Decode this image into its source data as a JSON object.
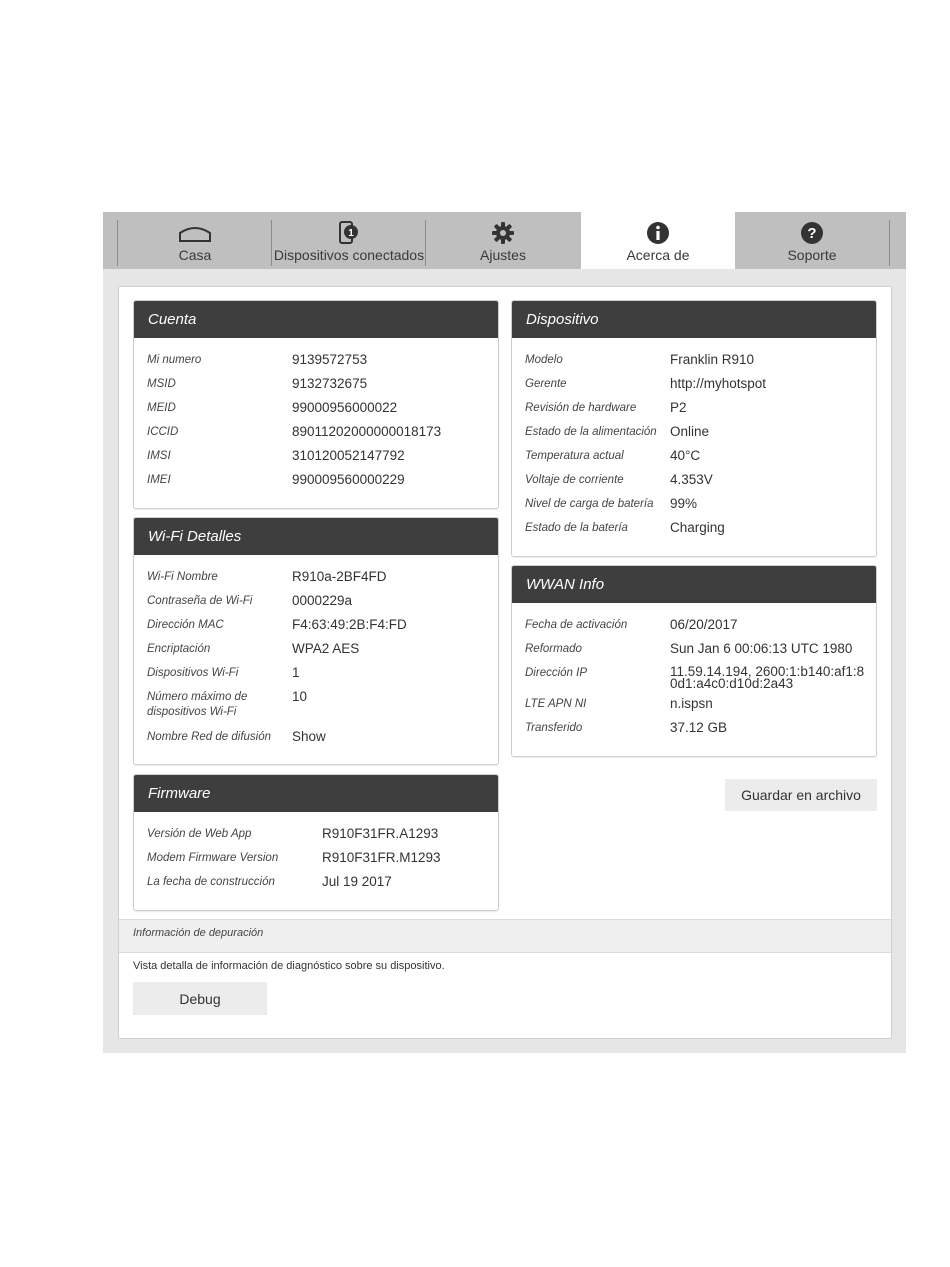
{
  "tabs": [
    {
      "label": "Casa",
      "icon": "home-icon"
    },
    {
      "label": "Dispositivos conectados",
      "icon": "connected-devices-icon"
    },
    {
      "label": "Ajustes",
      "icon": "gear-icon"
    },
    {
      "label": "Acerca de",
      "icon": "info-icon"
    },
    {
      "label": "Soporte",
      "icon": "help-icon"
    }
  ],
  "active_tab": "Acerca de",
  "cuenta": {
    "title": "Cuenta",
    "rows": [
      {
        "label": "Mi numero",
        "value": "9139572753"
      },
      {
        "label": "MSID",
        "value": "9132732675"
      },
      {
        "label": "MEID",
        "value": "99000956000022"
      },
      {
        "label": "ICCID",
        "value": "89011202000000018173"
      },
      {
        "label": "IMSI",
        "value": "310120052147792"
      },
      {
        "label": "IMEI",
        "value": "990009560000229"
      }
    ]
  },
  "wifi": {
    "title": "Wi-Fi Detalles",
    "rows": [
      {
        "label": "Wi-Fi Nombre",
        "value": "R910a-2BF4FD"
      },
      {
        "label": "Contraseña de Wi-Fi",
        "value": "0000229a"
      },
      {
        "label": "Dirección MAC",
        "value": "F4:63:49:2B:F4:FD"
      },
      {
        "label": "Encriptación",
        "value": "WPA2 AES"
      },
      {
        "label": "Dispositivos Wi-Fi",
        "value": "1"
      },
      {
        "label": "Número máximo de dispositivos Wi-Fi",
        "value": "10"
      },
      {
        "label": "Nombre Red de difusión",
        "value": "Show"
      }
    ]
  },
  "firmware": {
    "title": "Firmware",
    "rows": [
      {
        "label": "Versión de Web App",
        "value": "R910F31FR.A1293"
      },
      {
        "label": "Modem Firmware Version",
        "value": "R910F31FR.M1293"
      },
      {
        "label": "La fecha de construcción",
        "value": "Jul 19 2017"
      }
    ]
  },
  "dispositivo": {
    "title": "Dispositivo",
    "rows": [
      {
        "label": "Modelo",
        "value": "Franklin R910"
      },
      {
        "label": "Gerente",
        "value": "http://myhotspot"
      },
      {
        "label": "Revisión de hardware",
        "value": "P2"
      },
      {
        "label": "Estado de la alimentación",
        "value": "Online"
      },
      {
        "label": "Temperatura actual",
        "value": "40°C"
      },
      {
        "label": "Voltaje de corriente",
        "value": "4.353V"
      },
      {
        "label": "Nivel de carga de batería",
        "value": "99%"
      },
      {
        "label": "Estado de la batería",
        "value": "Charging"
      }
    ]
  },
  "wwan": {
    "title": "WWAN Info",
    "rows": [
      {
        "label": "Fecha de activación",
        "value": "06/20/2017"
      },
      {
        "label": "Reformado",
        "value": "Sun Jan 6 00:06:13 UTC 1980"
      },
      {
        "label": "Dirección IP",
        "value": "11.59.14.194, 2600:1:b140:af1:80d1:a4c0:d10d:2a43"
      },
      {
        "label": "LTE APN NI",
        "value": "n.ispsn"
      },
      {
        "label": "Transferido",
        "value": "37.12 GB"
      }
    ]
  },
  "save_button": "Guardar en archivo",
  "debug": {
    "title": "Información de depuración",
    "description": "Vista detalla de información de diagnóstico sobre su dispositivo.",
    "button": "Debug"
  }
}
